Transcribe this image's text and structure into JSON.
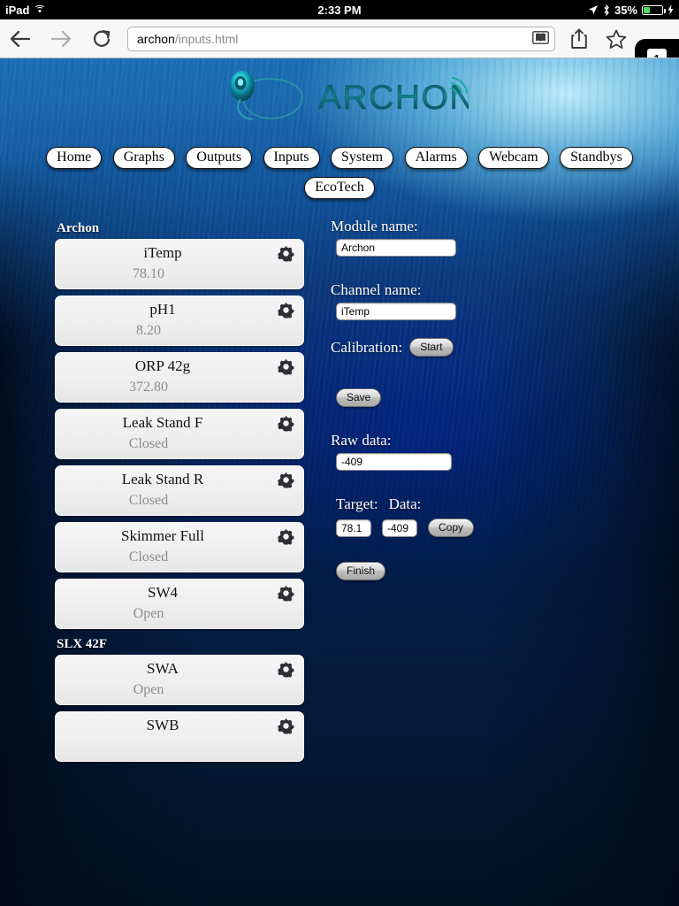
{
  "status_bar": {
    "device_label": "iPad",
    "wifi_icon": "wifi-icon",
    "time": "2:33 PM",
    "location_icon": "location-arrow-icon",
    "bluetooth_icon": "bluetooth-icon",
    "battery_percent": "35%",
    "battery_level": 35,
    "battery_icon": "battery-icon",
    "charging_icon": "lightning-bolt-icon"
  },
  "browser": {
    "back_icon": "back-arrow-icon",
    "forward_icon": "forward-arrow-icon",
    "reload_icon": "reload-icon",
    "url_host": "archon",
    "url_path": "/inputs.html",
    "reader_icon": "reader-view-icon",
    "share_icon": "share-icon",
    "bookmark_icon": "bookmark-star-icon",
    "tab_count": "1"
  },
  "logo": {
    "wordmark": "ARCHON",
    "mark_icon": "archon-circle-logo-icon",
    "signal_icon": "wifi-signal-icon"
  },
  "nav": {
    "row1": [
      {
        "label": "Home",
        "name": "nav-home"
      },
      {
        "label": "Graphs",
        "name": "nav-graphs"
      },
      {
        "label": "Outputs",
        "name": "nav-outputs"
      },
      {
        "label": "Inputs",
        "name": "nav-inputs"
      },
      {
        "label": "System",
        "name": "nav-system"
      },
      {
        "label": "Alarms",
        "name": "nav-alarms"
      },
      {
        "label": "Webcam",
        "name": "nav-webcam"
      },
      {
        "label": "Standbys",
        "name": "nav-standbys"
      }
    ],
    "row2": [
      {
        "label": "EcoTech",
        "name": "nav-ecotech"
      }
    ]
  },
  "channel_list": {
    "groups": [
      {
        "header": "Archon",
        "items": [
          {
            "name": "iTemp",
            "value": "78.10"
          },
          {
            "name": "pH1",
            "value": "8.20"
          },
          {
            "name": "ORP 42g",
            "value": "372.80"
          },
          {
            "name": "Leak Stand F",
            "value": "Closed"
          },
          {
            "name": "Leak Stand R",
            "value": "Closed"
          },
          {
            "name": "Skimmer Full",
            "value": "Closed"
          },
          {
            "name": "SW4",
            "value": "Open"
          }
        ]
      },
      {
        "header": "SLX 42F",
        "items": [
          {
            "name": "SWA",
            "value": "Open"
          },
          {
            "name": "SWB",
            "value": ""
          }
        ]
      }
    ],
    "gear_icon": "gear-icon"
  },
  "form": {
    "module_name_label": "Module name:",
    "module_name_value": "Archon",
    "channel_name_label": "Channel name:",
    "channel_name_value": "iTemp",
    "calibration_label": "Calibration:",
    "start_button": "Start",
    "save_button": "Save",
    "raw_data_label": "Raw data:",
    "raw_data_value": "-409",
    "target_label": "Target:",
    "data_label": "Data:",
    "target_value": "78.1",
    "data_value": "-409",
    "copy_button": "Copy",
    "finish_button": "Finish"
  },
  "colors": {
    "accent_teal": "#1fb6b0",
    "water_top": "#1a6fb5",
    "water_bottom": "#021124",
    "battery_green": "#4cd964",
    "item_bg": "#efefef",
    "item_value_text": "#8c8c8c"
  }
}
